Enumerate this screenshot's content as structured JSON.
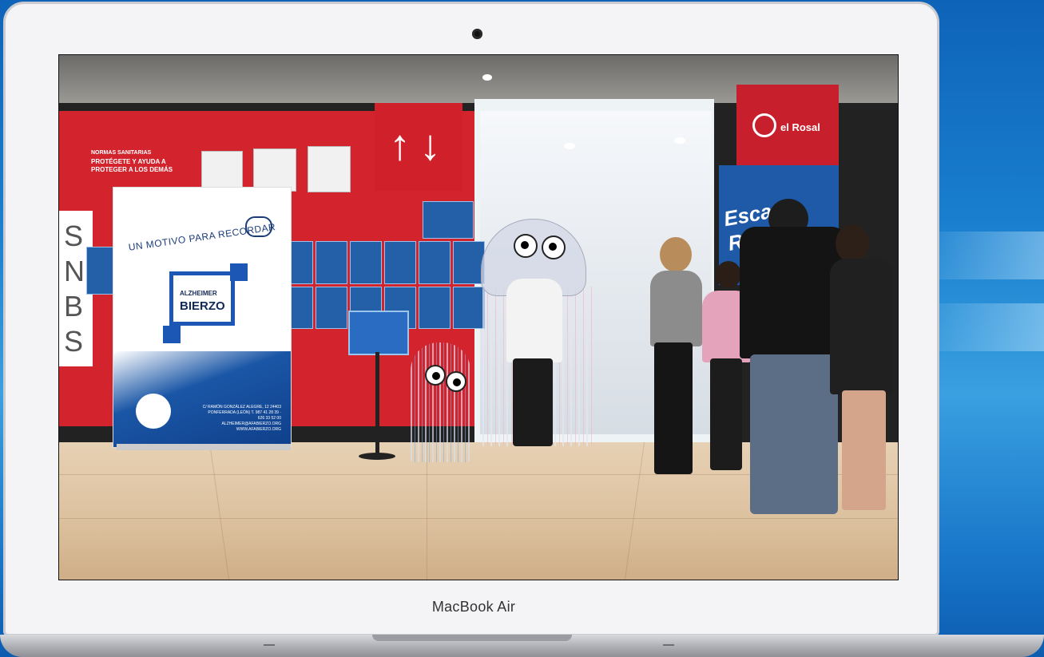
{
  "device": {
    "brand_label": "MacBook Air"
  },
  "photo": {
    "rollup_banner": {
      "tagline": "UN MOTIVO PARA RECORDAR",
      "logo_line1": "ALZHEIMER",
      "logo_line2": "BIERZO",
      "address": "C/ RAMÓN GONZÁLEZ ALEGRE, 12 24403 PONFERRADA (LEÓN) T. 987 41 28 39 · 626 33 52 00 ALZHEIMER@AFABIERZO.ORG WWW.AFABIERZO.ORG"
    },
    "wall_notice": {
      "line1": "NORMAS SANITARIAS",
      "line2": "PROTÉGETE Y AYUDA A PROTEGER A LOS DEMÁS"
    },
    "left_letters": "SNBS",
    "store_sign": "el Rosal",
    "escape_banner": "Escape Room",
    "colors": {
      "wall_red": "#d3242e",
      "banner_blue": "#1c57b5",
      "backdrop_blue": "#1a80cf"
    }
  }
}
